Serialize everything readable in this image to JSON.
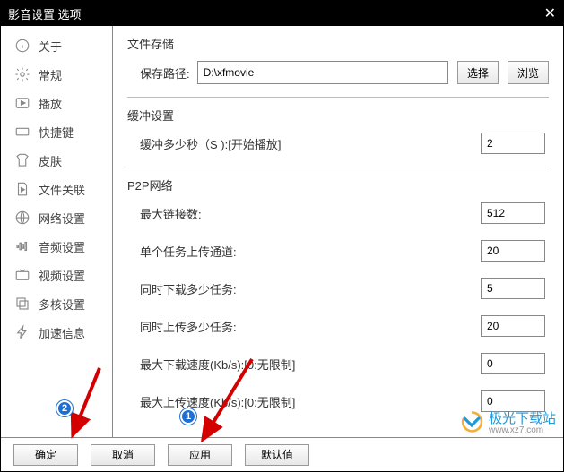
{
  "title": "影音设置 选项",
  "sidebar": {
    "items": [
      {
        "label": "关于"
      },
      {
        "label": "常规"
      },
      {
        "label": "播放"
      },
      {
        "label": "快捷键"
      },
      {
        "label": "皮肤"
      },
      {
        "label": "文件关联"
      },
      {
        "label": "网络设置"
      },
      {
        "label": "音频设置"
      },
      {
        "label": "视频设置"
      },
      {
        "label": "多核设置"
      },
      {
        "label": "加速信息"
      }
    ]
  },
  "sections": {
    "storage": {
      "title": "文件存储",
      "path_label": "保存路径:",
      "path_value": "D:\\xfmovie",
      "select": "选择",
      "browse": "浏览"
    },
    "buffer": {
      "title": "缓冲设置",
      "label": "缓冲多少秒（S ):[开始播放]",
      "value": "2"
    },
    "p2p": {
      "title": "P2P网络",
      "rows": [
        {
          "label": "最大链接数:",
          "value": "512"
        },
        {
          "label": "单个任务上传通道:",
          "value": "20"
        },
        {
          "label": "同时下载多少任务:",
          "value": "5"
        },
        {
          "label": "同时上传多少任务:",
          "value": "20"
        },
        {
          "label": "最大下载速度(Kb/s):[0:无限制]",
          "value": "0"
        },
        {
          "label": "最大上传速度(Kb/s):[0:无限制]",
          "value": "0"
        }
      ]
    }
  },
  "footer": {
    "ok": "确定",
    "cancel": "取消",
    "apply": "应用",
    "default": "默认值"
  },
  "markers": {
    "one": "1",
    "two": "2"
  },
  "watermark": {
    "text": "极光下载站",
    "sub": "www.xz7.com"
  }
}
